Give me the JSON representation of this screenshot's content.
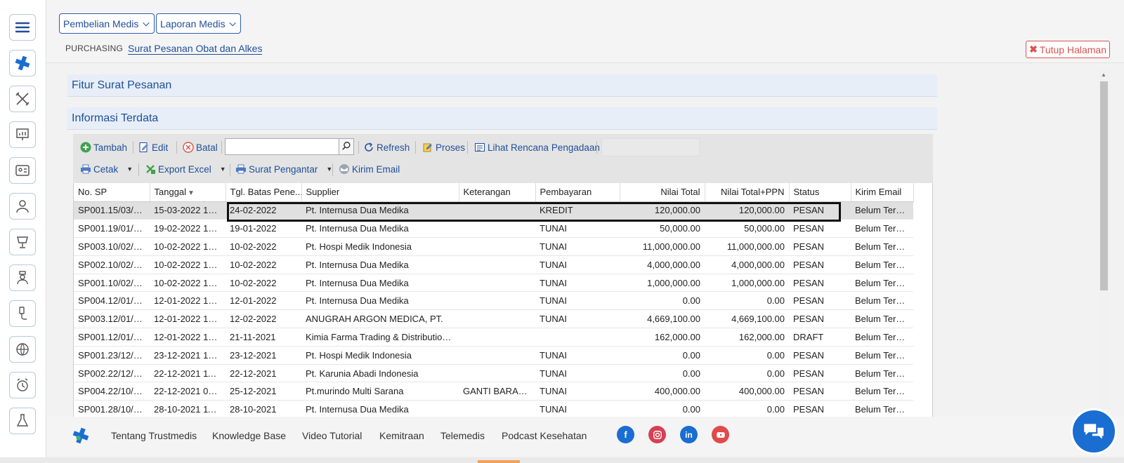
{
  "header": {
    "menu_pembelian": "Pembelian Medis",
    "menu_laporan": "Laporan Medis",
    "breadcrumb_root": "PURCHASING",
    "breadcrumb_page": "Surat Pesanan Obat dan Alkes",
    "close_label": "Tutup Halaman"
  },
  "panels": {
    "fitur": "Fitur Surat Pesanan",
    "informasi": "Informasi Terdata"
  },
  "toolbar": {
    "tambah": "Tambah",
    "edit": "Edit",
    "batal": "Batal",
    "search_value": "",
    "refresh": "Refresh",
    "proses": "Proses",
    "lihat_rencana": "Lihat Rencana Pengadaan",
    "cetak": "Cetak",
    "export_excel": "Export Excel",
    "surat_pengantar": "Surat Pengantar",
    "kirim_email": "Kirim Email"
  },
  "table": {
    "columns": [
      "No. SP",
      "Tanggal",
      "Tgl. Batas Pene...",
      "Supplier",
      "Keterangan",
      "Pembayaran",
      "Nilai Total",
      "Nilai Total+PPN",
      "Status",
      "Kirim Email"
    ],
    "sorted_column": "Tanggal",
    "selected_row": 0,
    "rows": [
      [
        "SP001.15/03/2...",
        "15-03-2022 13:...",
        "24-02-2022",
        "Pt. Internusa Dua Medika",
        "",
        "KREDIT",
        "120,000.00",
        "120,000.00",
        "PESAN",
        "Belum Terki..."
      ],
      [
        "SP001.19/01/2...",
        "19-02-2022 14:...",
        "19-01-2022",
        "Pt. Internusa Dua Medika",
        "",
        "TUNAI",
        "50,000.00",
        "50,000.00",
        "PESAN",
        "Belum Terki..."
      ],
      [
        "SP003.10/02/2...",
        "10-02-2022 15:...",
        "10-02-2022",
        "Pt. Hospi Medik Indonesia",
        "",
        "TUNAI",
        "11,000,000.00",
        "11,000,000.00",
        "PESAN",
        "Belum Terki..."
      ],
      [
        "SP002.10/02/2...",
        "10-02-2022 15:...",
        "10-02-2022",
        "Pt. Internusa Dua Medika",
        "",
        "TUNAI",
        "4,000,000.00",
        "4,000,000.00",
        "PESAN",
        "Belum Terki..."
      ],
      [
        "SP001.10/02/2...",
        "10-02-2022 14:...",
        "10-02-2022",
        "Pt. Internusa Dua Medika",
        "",
        "TUNAI",
        "1,000,000.00",
        "1,000,000.00",
        "PESAN",
        "Belum Terki..."
      ],
      [
        "SP004.12/01/2...",
        "12-01-2022 16:...",
        "12-01-2022",
        "Pt. Internusa Dua Medika",
        "",
        "TUNAI",
        "0.00",
        "0.00",
        "PESAN",
        "Belum Terki..."
      ],
      [
        "SP003.12/01/2...",
        "12-01-2022 15:...",
        "12-02-2022",
        "ANUGRAH ARGON MEDICA, PT.",
        "",
        "TUNAI",
        "4,669,100.00",
        "4,669,100.00",
        "PESAN",
        "Belum Terki..."
      ],
      [
        "SP001.12/01/2...",
        "12-01-2022 13:...",
        "21-11-2021",
        "Kimia Farma Trading & Distribution ...",
        "",
        "",
        "162,000.00",
        "162,000.00",
        "DRAFT",
        "Belum Terki..."
      ],
      [
        "SP001.23/12/2...",
        "23-12-2021 13:...",
        "23-12-2021",
        "Pt. Hospi Medik Indonesia",
        "",
        "TUNAI",
        "0.00",
        "0.00",
        "PESAN",
        "Belum Terki..."
      ],
      [
        "SP002.22/12/2...",
        "22-12-2021 11:...",
        "22-12-2021",
        "Pt. Karunia Abadi Indonesia",
        "",
        "TUNAI",
        "0.00",
        "0.00",
        "PESAN",
        "Belum Terki..."
      ],
      [
        "SP004.22/10/2...",
        "22-12-2021 09:...",
        "25-12-2021",
        "Pt.murindo Multi Sarana",
        "GANTI BARAN...",
        "TUNAI",
        "400,000.00",
        "400,000.00",
        "PESAN",
        "Belum Terki..."
      ],
      [
        "SP001.28/10/2...",
        "28-10-2021 11:...",
        "28-10-2021",
        "Pt. Internusa Dua Medika",
        "",
        "TUNAI",
        "0.00",
        "0.00",
        "PESAN",
        "Belum Terki..."
      ]
    ]
  },
  "footer": {
    "links": [
      "Tentang Trustmedis",
      "Knowledge Base",
      "Video Tutorial",
      "Kemitraan",
      "Telemedis",
      "Podcast Kesehatan"
    ],
    "social": [
      "facebook-icon",
      "instagram-icon",
      "linkedin-icon",
      "youtube-icon"
    ]
  },
  "colors": {
    "accent": "#1f4f99",
    "danger": "#d9534f",
    "panel_bg": "#e7eef8",
    "chat_button": "#1a6dd1"
  }
}
